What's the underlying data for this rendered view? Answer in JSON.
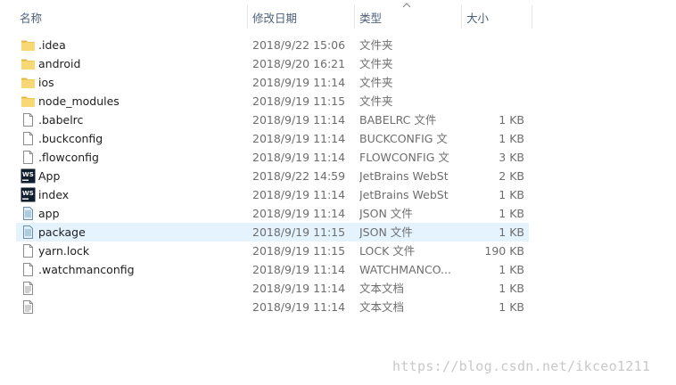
{
  "columns": {
    "name": "名称",
    "date": "修改日期",
    "type": "类型",
    "size": "大小"
  },
  "files": [
    {
      "name": ".idea",
      "date": "2018/9/22 15:06",
      "type": "文件夹",
      "size": "",
      "icon": "folder-icon"
    },
    {
      "name": "android",
      "date": "2018/9/20 16:21",
      "type": "文件夹",
      "size": "",
      "icon": "folder-icon"
    },
    {
      "name": "ios",
      "date": "2018/9/19 11:14",
      "type": "文件夹",
      "size": "",
      "icon": "folder-icon"
    },
    {
      "name": "node_modules",
      "date": "2018/9/19 11:15",
      "type": "文件夹",
      "size": "",
      "icon": "folder-icon"
    },
    {
      "name": ".babelrc",
      "date": "2018/9/19 11:14",
      "type": "BABELRC 文件",
      "size": "1 KB",
      "icon": "blank-file-icon"
    },
    {
      "name": ".buckconfig",
      "date": "2018/9/19 11:14",
      "type": "BUCKCONFIG 文",
      "size": "1 KB",
      "icon": "blank-file-icon"
    },
    {
      "name": ".flowconfig",
      "date": "2018/9/19 11:14",
      "type": "FLOWCONFIG 文",
      "size": "3 KB",
      "icon": "blank-file-icon"
    },
    {
      "name": "App",
      "date": "2018/9/22 14:59",
      "type": "JetBrains WebSt",
      "size": "2 KB",
      "icon": "webstorm-icon"
    },
    {
      "name": "index",
      "date": "2018/9/19 11:14",
      "type": "JetBrains WebSt",
      "size": "1 KB",
      "icon": "webstorm-icon"
    },
    {
      "name": "app",
      "date": "2018/9/19 11:14",
      "type": "JSON 文件",
      "size": "1 KB",
      "icon": "json-file-icon"
    },
    {
      "name": "package",
      "date": "2018/9/19 11:15",
      "type": "JSON 文件",
      "size": "1 KB",
      "icon": "json-file-icon",
      "selected": true
    },
    {
      "name": "yarn.lock",
      "date": "2018/9/19 11:15",
      "type": "LOCK 文件",
      "size": "190 KB",
      "icon": "blank-file-icon"
    },
    {
      "name": ".watchmanconfig",
      "date": "2018/9/19 11:14",
      "type": "WATCHMANCO...",
      "size": "1 KB",
      "icon": "blank-file-icon"
    },
    {
      "name": "",
      "date": "2018/9/19 11:14",
      "type": "文本文档",
      "size": "1 KB",
      "icon": "text-file-icon"
    },
    {
      "name": "",
      "date": "2018/9/19 11:14",
      "type": "文本文档",
      "size": "1 KB",
      "icon": "text-file-icon"
    }
  ],
  "watermark": "https://blog.csdn.net/ikceo1211",
  "colors": {
    "selected_row": "#e5f3ff",
    "folder": "#f8d775",
    "header_text": "#4c607a"
  }
}
